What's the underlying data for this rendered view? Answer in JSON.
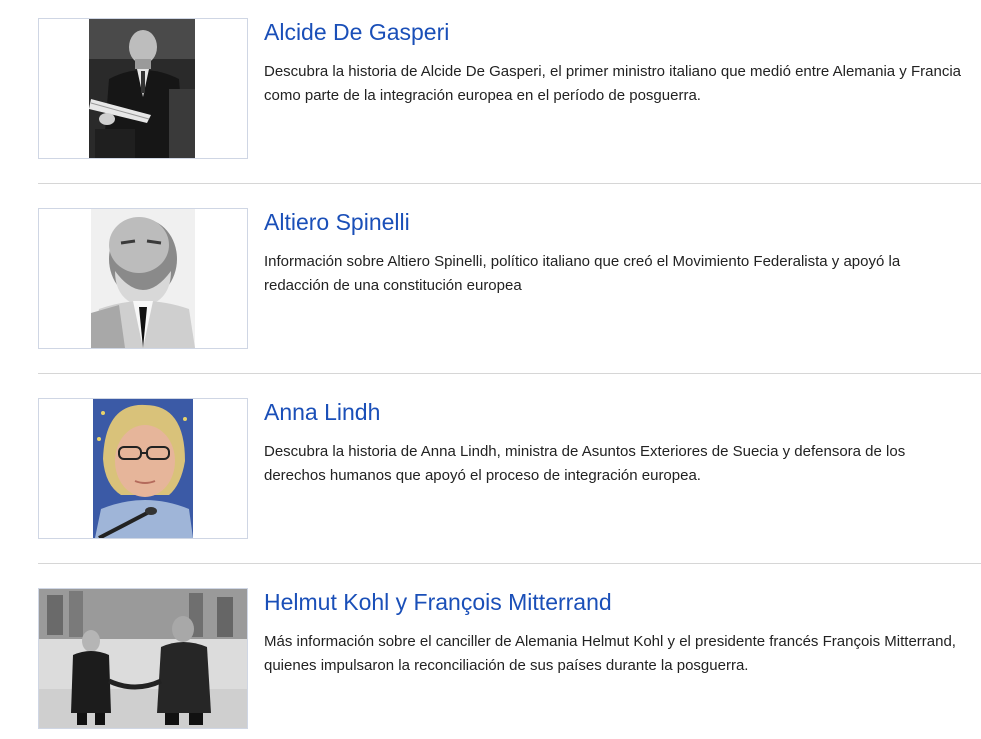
{
  "items": [
    {
      "title": "Alcide De Gasperi",
      "description": "Descubra la historia de Alcide De Gasperi, el primer ministro italiano que medió entre Alemania y Francia como parte de la integración europea en el período de posguerra."
    },
    {
      "title": "Altiero Spinelli",
      "description": "Información sobre Altiero Spinelli, político italiano que creó el Movimiento Federalista y apoyó la redacción de una constitución europea"
    },
    {
      "title": "Anna Lindh",
      "description": "Descubra la historia de Anna Lindh, ministra de Asuntos Exteriores de Suecia y defensora de los derechos humanos que apoyó el proceso de integración europea."
    },
    {
      "title": "Helmut Kohl y François Mitterrand",
      "description": "Más información sobre el canciller de Alemania Helmut Kohl y el presidente francés François Mitterrand, quienes impulsaron la reconciliación de sus países durante la posguerra."
    }
  ],
  "colors": {
    "link": "#1a4fb8",
    "text": "#222222",
    "divider": "#d6d6d6",
    "thumb_border": "#cfd6e4"
  }
}
